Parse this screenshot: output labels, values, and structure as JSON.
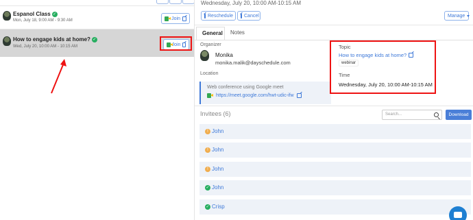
{
  "left_panel": {
    "events": [
      {
        "title": "Espanol Class",
        "time": "Mon, July 18, 9:00 AM - 9:30 AM",
        "join_label": "Join"
      },
      {
        "title": "How to engage kids at home?",
        "time": "Wed, July 20, 10:00 AM - 10:15 AM",
        "join_label": "Join"
      }
    ]
  },
  "header": {
    "datetime": "Wednesday, July 20, 10:00 AM-10:15 AM",
    "reschedule_label": "Reschedule",
    "cancel_label": "Cancel",
    "manage_label": "Manage"
  },
  "tabs": [
    {
      "label": "General"
    },
    {
      "label": "Notes"
    }
  ],
  "details": {
    "organizer_label": "Organizer",
    "organizer_name": "Monika",
    "organizer_email": "monika.malik@dayschedule.com",
    "location_label": "Location",
    "location_title": "Web conference using Google meet",
    "location_link": "https://meet.google.com/hwt-udic-ifw"
  },
  "topic": {
    "label": "Topic",
    "title": "How to engage kids at home?",
    "tag": "webinar",
    "time_label": "Time",
    "time_value": "Wednesday, July 20, 10:00 AM-10:15 AM"
  },
  "invitees": {
    "title": "Invitees (6)",
    "search_placeholder": "Search...",
    "download_label": "Download",
    "rows": [
      {
        "name": "John",
        "status": "pending"
      },
      {
        "name": "John",
        "status": "pending"
      },
      {
        "name": "John",
        "status": "pending"
      },
      {
        "name": "John",
        "status": "accepted"
      },
      {
        "name": "Crisp",
        "status": "accepted"
      }
    ]
  },
  "colors": {
    "accent": "#3d78d8",
    "highlight_border": "#ee1111",
    "accepted": "#27ae60",
    "pending": "#f0ad4e"
  }
}
